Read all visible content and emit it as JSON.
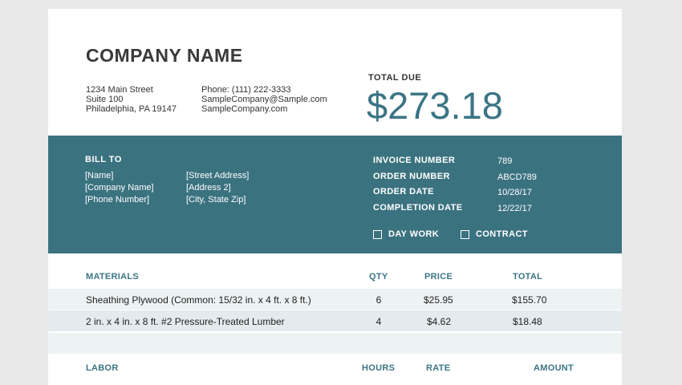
{
  "company": {
    "name": "COMPANY NAME",
    "address": [
      "1234 Main Street",
      "Suite 100",
      "Philadelphia, PA 19147"
    ],
    "contact": [
      "Phone: (111) 222-3333",
      "SampleCompany@Sample.com",
      "SampleCompany.com"
    ]
  },
  "total_due": {
    "label": "TOTAL DUE",
    "value": "$273.18"
  },
  "bill_to": {
    "label": "BILL TO",
    "col1": [
      "[Name]",
      "[Company Name]",
      "[Phone Number]"
    ],
    "col2": [
      "[Street Address]",
      "[Address 2]",
      "[City, State Zip]"
    ]
  },
  "invoice": {
    "labels": [
      "INVOICE NUMBER",
      "ORDER NUMBER",
      "ORDER DATE",
      "COMPLETION DATE"
    ],
    "values": [
      "789",
      "ABCD789",
      "10/28/17",
      "12/22/17"
    ]
  },
  "checkboxes": {
    "day_work": "DAY WORK",
    "contract": "CONTRACT"
  },
  "materials": {
    "headers": {
      "item": "MATERIALS",
      "qty": "QTY",
      "price": "PRICE",
      "total": "TOTAL"
    },
    "rows": [
      {
        "item": "Sheathing Plywood (Common: 15/32 in. x 4 ft. x 8 ft.)",
        "qty": "6",
        "price": "$25.95",
        "total": "$155.70"
      },
      {
        "item": "2 in. x 4 in. x 8 ft. #2 Pressure-Treated Lumber",
        "qty": "4",
        "price": "$4.62",
        "total": "$18.48"
      }
    ]
  },
  "labor": {
    "headers": {
      "item": "LABOR",
      "hours": "HOURS",
      "rate": "RATE",
      "amount": "AMOUNT"
    }
  }
}
